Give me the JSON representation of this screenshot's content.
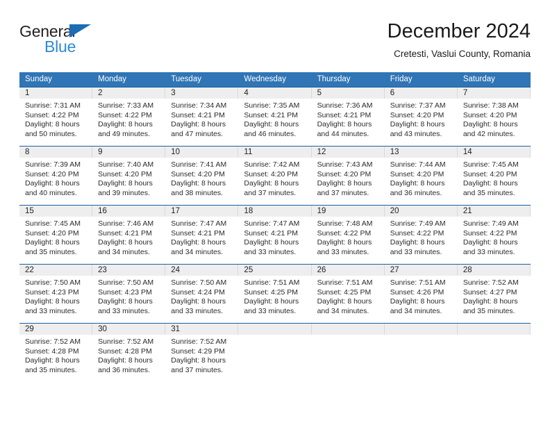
{
  "brand": {
    "word_top": "General",
    "word_bottom": "Blue",
    "triangle_color": "#1b6cb5",
    "blue_text_color": "#2b8bd4"
  },
  "header": {
    "title": "December 2024",
    "subtitle": "Cretesti, Vaslui County, Romania"
  },
  "theme": {
    "header_blue": "#3075b5",
    "row_rule_blue": "#1b5fa0",
    "daynum_bg": "#eeeeee"
  },
  "weekdays": [
    "Sunday",
    "Monday",
    "Tuesday",
    "Wednesday",
    "Thursday",
    "Friday",
    "Saturday"
  ],
  "weeks": [
    [
      {
        "day": "1",
        "sunrise": "Sunrise: 7:31 AM",
        "sunset": "Sunset: 4:22 PM",
        "daylight1": "Daylight: 8 hours",
        "daylight2": "and 50 minutes."
      },
      {
        "day": "2",
        "sunrise": "Sunrise: 7:33 AM",
        "sunset": "Sunset: 4:22 PM",
        "daylight1": "Daylight: 8 hours",
        "daylight2": "and 49 minutes."
      },
      {
        "day": "3",
        "sunrise": "Sunrise: 7:34 AM",
        "sunset": "Sunset: 4:21 PM",
        "daylight1": "Daylight: 8 hours",
        "daylight2": "and 47 minutes."
      },
      {
        "day": "4",
        "sunrise": "Sunrise: 7:35 AM",
        "sunset": "Sunset: 4:21 PM",
        "daylight1": "Daylight: 8 hours",
        "daylight2": "and 46 minutes."
      },
      {
        "day": "5",
        "sunrise": "Sunrise: 7:36 AM",
        "sunset": "Sunset: 4:21 PM",
        "daylight1": "Daylight: 8 hours",
        "daylight2": "and 44 minutes."
      },
      {
        "day": "6",
        "sunrise": "Sunrise: 7:37 AM",
        "sunset": "Sunset: 4:20 PM",
        "daylight1": "Daylight: 8 hours",
        "daylight2": "and 43 minutes."
      },
      {
        "day": "7",
        "sunrise": "Sunrise: 7:38 AM",
        "sunset": "Sunset: 4:20 PM",
        "daylight1": "Daylight: 8 hours",
        "daylight2": "and 42 minutes."
      }
    ],
    [
      {
        "day": "8",
        "sunrise": "Sunrise: 7:39 AM",
        "sunset": "Sunset: 4:20 PM",
        "daylight1": "Daylight: 8 hours",
        "daylight2": "and 40 minutes."
      },
      {
        "day": "9",
        "sunrise": "Sunrise: 7:40 AM",
        "sunset": "Sunset: 4:20 PM",
        "daylight1": "Daylight: 8 hours",
        "daylight2": "and 39 minutes."
      },
      {
        "day": "10",
        "sunrise": "Sunrise: 7:41 AM",
        "sunset": "Sunset: 4:20 PM",
        "daylight1": "Daylight: 8 hours",
        "daylight2": "and 38 minutes."
      },
      {
        "day": "11",
        "sunrise": "Sunrise: 7:42 AM",
        "sunset": "Sunset: 4:20 PM",
        "daylight1": "Daylight: 8 hours",
        "daylight2": "and 37 minutes."
      },
      {
        "day": "12",
        "sunrise": "Sunrise: 7:43 AM",
        "sunset": "Sunset: 4:20 PM",
        "daylight1": "Daylight: 8 hours",
        "daylight2": "and 37 minutes."
      },
      {
        "day": "13",
        "sunrise": "Sunrise: 7:44 AM",
        "sunset": "Sunset: 4:20 PM",
        "daylight1": "Daylight: 8 hours",
        "daylight2": "and 36 minutes."
      },
      {
        "day": "14",
        "sunrise": "Sunrise: 7:45 AM",
        "sunset": "Sunset: 4:20 PM",
        "daylight1": "Daylight: 8 hours",
        "daylight2": "and 35 minutes."
      }
    ],
    [
      {
        "day": "15",
        "sunrise": "Sunrise: 7:45 AM",
        "sunset": "Sunset: 4:20 PM",
        "daylight1": "Daylight: 8 hours",
        "daylight2": "and 35 minutes."
      },
      {
        "day": "16",
        "sunrise": "Sunrise: 7:46 AM",
        "sunset": "Sunset: 4:21 PM",
        "daylight1": "Daylight: 8 hours",
        "daylight2": "and 34 minutes."
      },
      {
        "day": "17",
        "sunrise": "Sunrise: 7:47 AM",
        "sunset": "Sunset: 4:21 PM",
        "daylight1": "Daylight: 8 hours",
        "daylight2": "and 34 minutes."
      },
      {
        "day": "18",
        "sunrise": "Sunrise: 7:47 AM",
        "sunset": "Sunset: 4:21 PM",
        "daylight1": "Daylight: 8 hours",
        "daylight2": "and 33 minutes."
      },
      {
        "day": "19",
        "sunrise": "Sunrise: 7:48 AM",
        "sunset": "Sunset: 4:22 PM",
        "daylight1": "Daylight: 8 hours",
        "daylight2": "and 33 minutes."
      },
      {
        "day": "20",
        "sunrise": "Sunrise: 7:49 AM",
        "sunset": "Sunset: 4:22 PM",
        "daylight1": "Daylight: 8 hours",
        "daylight2": "and 33 minutes."
      },
      {
        "day": "21",
        "sunrise": "Sunrise: 7:49 AM",
        "sunset": "Sunset: 4:22 PM",
        "daylight1": "Daylight: 8 hours",
        "daylight2": "and 33 minutes."
      }
    ],
    [
      {
        "day": "22",
        "sunrise": "Sunrise: 7:50 AM",
        "sunset": "Sunset: 4:23 PM",
        "daylight1": "Daylight: 8 hours",
        "daylight2": "and 33 minutes."
      },
      {
        "day": "23",
        "sunrise": "Sunrise: 7:50 AM",
        "sunset": "Sunset: 4:23 PM",
        "daylight1": "Daylight: 8 hours",
        "daylight2": "and 33 minutes."
      },
      {
        "day": "24",
        "sunrise": "Sunrise: 7:50 AM",
        "sunset": "Sunset: 4:24 PM",
        "daylight1": "Daylight: 8 hours",
        "daylight2": "and 33 minutes."
      },
      {
        "day": "25",
        "sunrise": "Sunrise: 7:51 AM",
        "sunset": "Sunset: 4:25 PM",
        "daylight1": "Daylight: 8 hours",
        "daylight2": "and 33 minutes."
      },
      {
        "day": "26",
        "sunrise": "Sunrise: 7:51 AM",
        "sunset": "Sunset: 4:25 PM",
        "daylight1": "Daylight: 8 hours",
        "daylight2": "and 34 minutes."
      },
      {
        "day": "27",
        "sunrise": "Sunrise: 7:51 AM",
        "sunset": "Sunset: 4:26 PM",
        "daylight1": "Daylight: 8 hours",
        "daylight2": "and 34 minutes."
      },
      {
        "day": "28",
        "sunrise": "Sunrise: 7:52 AM",
        "sunset": "Sunset: 4:27 PM",
        "daylight1": "Daylight: 8 hours",
        "daylight2": "and 35 minutes."
      }
    ],
    [
      {
        "day": "29",
        "sunrise": "Sunrise: 7:52 AM",
        "sunset": "Sunset: 4:28 PM",
        "daylight1": "Daylight: 8 hours",
        "daylight2": "and 35 minutes."
      },
      {
        "day": "30",
        "sunrise": "Sunrise: 7:52 AM",
        "sunset": "Sunset: 4:28 PM",
        "daylight1": "Daylight: 8 hours",
        "daylight2": "and 36 minutes."
      },
      {
        "day": "31",
        "sunrise": "Sunrise: 7:52 AM",
        "sunset": "Sunset: 4:29 PM",
        "daylight1": "Daylight: 8 hours",
        "daylight2": "and 37 minutes."
      },
      {
        "day": "",
        "sunrise": "",
        "sunset": "",
        "daylight1": "",
        "daylight2": ""
      },
      {
        "day": "",
        "sunrise": "",
        "sunset": "",
        "daylight1": "",
        "daylight2": ""
      },
      {
        "day": "",
        "sunrise": "",
        "sunset": "",
        "daylight1": "",
        "daylight2": ""
      },
      {
        "day": "",
        "sunrise": "",
        "sunset": "",
        "daylight1": "",
        "daylight2": ""
      }
    ]
  ]
}
